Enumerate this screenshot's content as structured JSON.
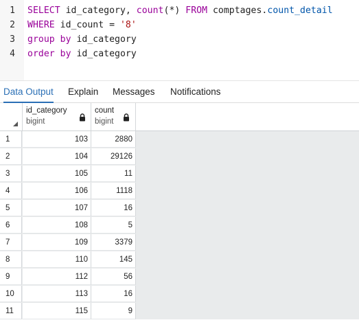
{
  "editor": {
    "lines": [
      {
        "num": "1",
        "tokens": [
          {
            "t": "SELECT",
            "c": "kw"
          },
          {
            "t": " id_category, ",
            "c": "id"
          },
          {
            "t": "count",
            "c": "kw"
          },
          {
            "t": "(*) ",
            "c": "id"
          },
          {
            "t": "FROM",
            "c": "kw"
          },
          {
            "t": " comptages.",
            "c": "id"
          },
          {
            "t": "count_detail",
            "c": "ref"
          }
        ]
      },
      {
        "num": "2",
        "tokens": [
          {
            "t": "WHERE",
            "c": "kw"
          },
          {
            "t": " id_count = ",
            "c": "id"
          },
          {
            "t": "'8'",
            "c": "str"
          }
        ]
      },
      {
        "num": "3",
        "tokens": [
          {
            "t": "group by",
            "c": "kw"
          },
          {
            "t": " id_category",
            "c": "id"
          }
        ]
      },
      {
        "num": "4",
        "tokens": [
          {
            "t": "order by",
            "c": "kw"
          },
          {
            "t": " id_category",
            "c": "id"
          }
        ]
      }
    ]
  },
  "tabs": {
    "data_output": "Data Output",
    "explain": "Explain",
    "messages": "Messages",
    "notifications": "Notifications",
    "active": "data_output"
  },
  "grid": {
    "columns": [
      {
        "name": "id_category",
        "type": "bigint",
        "icon": "lock-icon"
      },
      {
        "name": "count",
        "type": "bigint",
        "icon": "lock-icon"
      }
    ],
    "rows": [
      {
        "n": "1",
        "id_category": "103",
        "count": "2880"
      },
      {
        "n": "2",
        "id_category": "104",
        "count": "29126"
      },
      {
        "n": "3",
        "id_category": "105",
        "count": "11"
      },
      {
        "n": "4",
        "id_category": "106",
        "count": "1118"
      },
      {
        "n": "5",
        "id_category": "107",
        "count": "16"
      },
      {
        "n": "6",
        "id_category": "108",
        "count": "5"
      },
      {
        "n": "7",
        "id_category": "109",
        "count": "3379"
      },
      {
        "n": "8",
        "id_category": "110",
        "count": "145"
      },
      {
        "n": "9",
        "id_category": "112",
        "count": "56"
      },
      {
        "n": "10",
        "id_category": "113",
        "count": "16"
      },
      {
        "n": "11",
        "id_category": "115",
        "count": "9"
      }
    ]
  }
}
